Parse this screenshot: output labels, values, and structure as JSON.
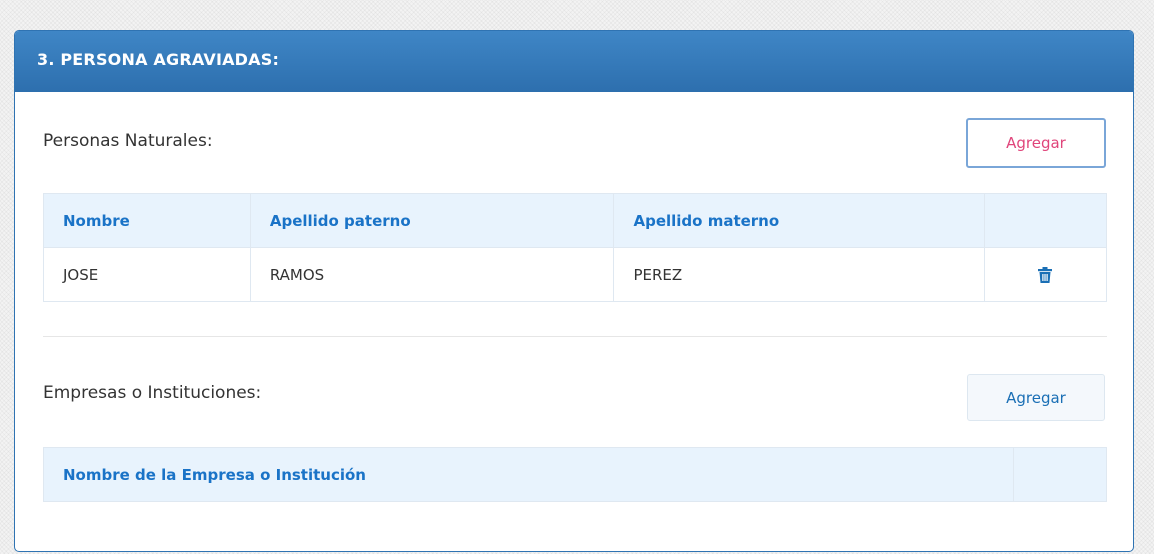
{
  "section": {
    "title": "3. PERSONA AGRAVIADAS:"
  },
  "personas_naturales": {
    "label": "Personas Naturales:",
    "add_label": "Agregar",
    "columns": [
      "Nombre",
      "Apellido paterno",
      "Apellido materno"
    ],
    "rows": [
      {
        "nombre": "JOSE",
        "apellido_paterno": "RAMOS",
        "apellido_materno": "PEREZ",
        "action_icon": "trash-icon"
      }
    ]
  },
  "empresas": {
    "label": "Empresas o Instituciones:",
    "add_label": "Agregar",
    "columns": [
      "Nombre de la Empresa o Institución"
    ],
    "rows": []
  },
  "colors": {
    "header_blue": "#2f73b2",
    "accent_pink": "#e0457b",
    "link_blue": "#1a73c7"
  }
}
